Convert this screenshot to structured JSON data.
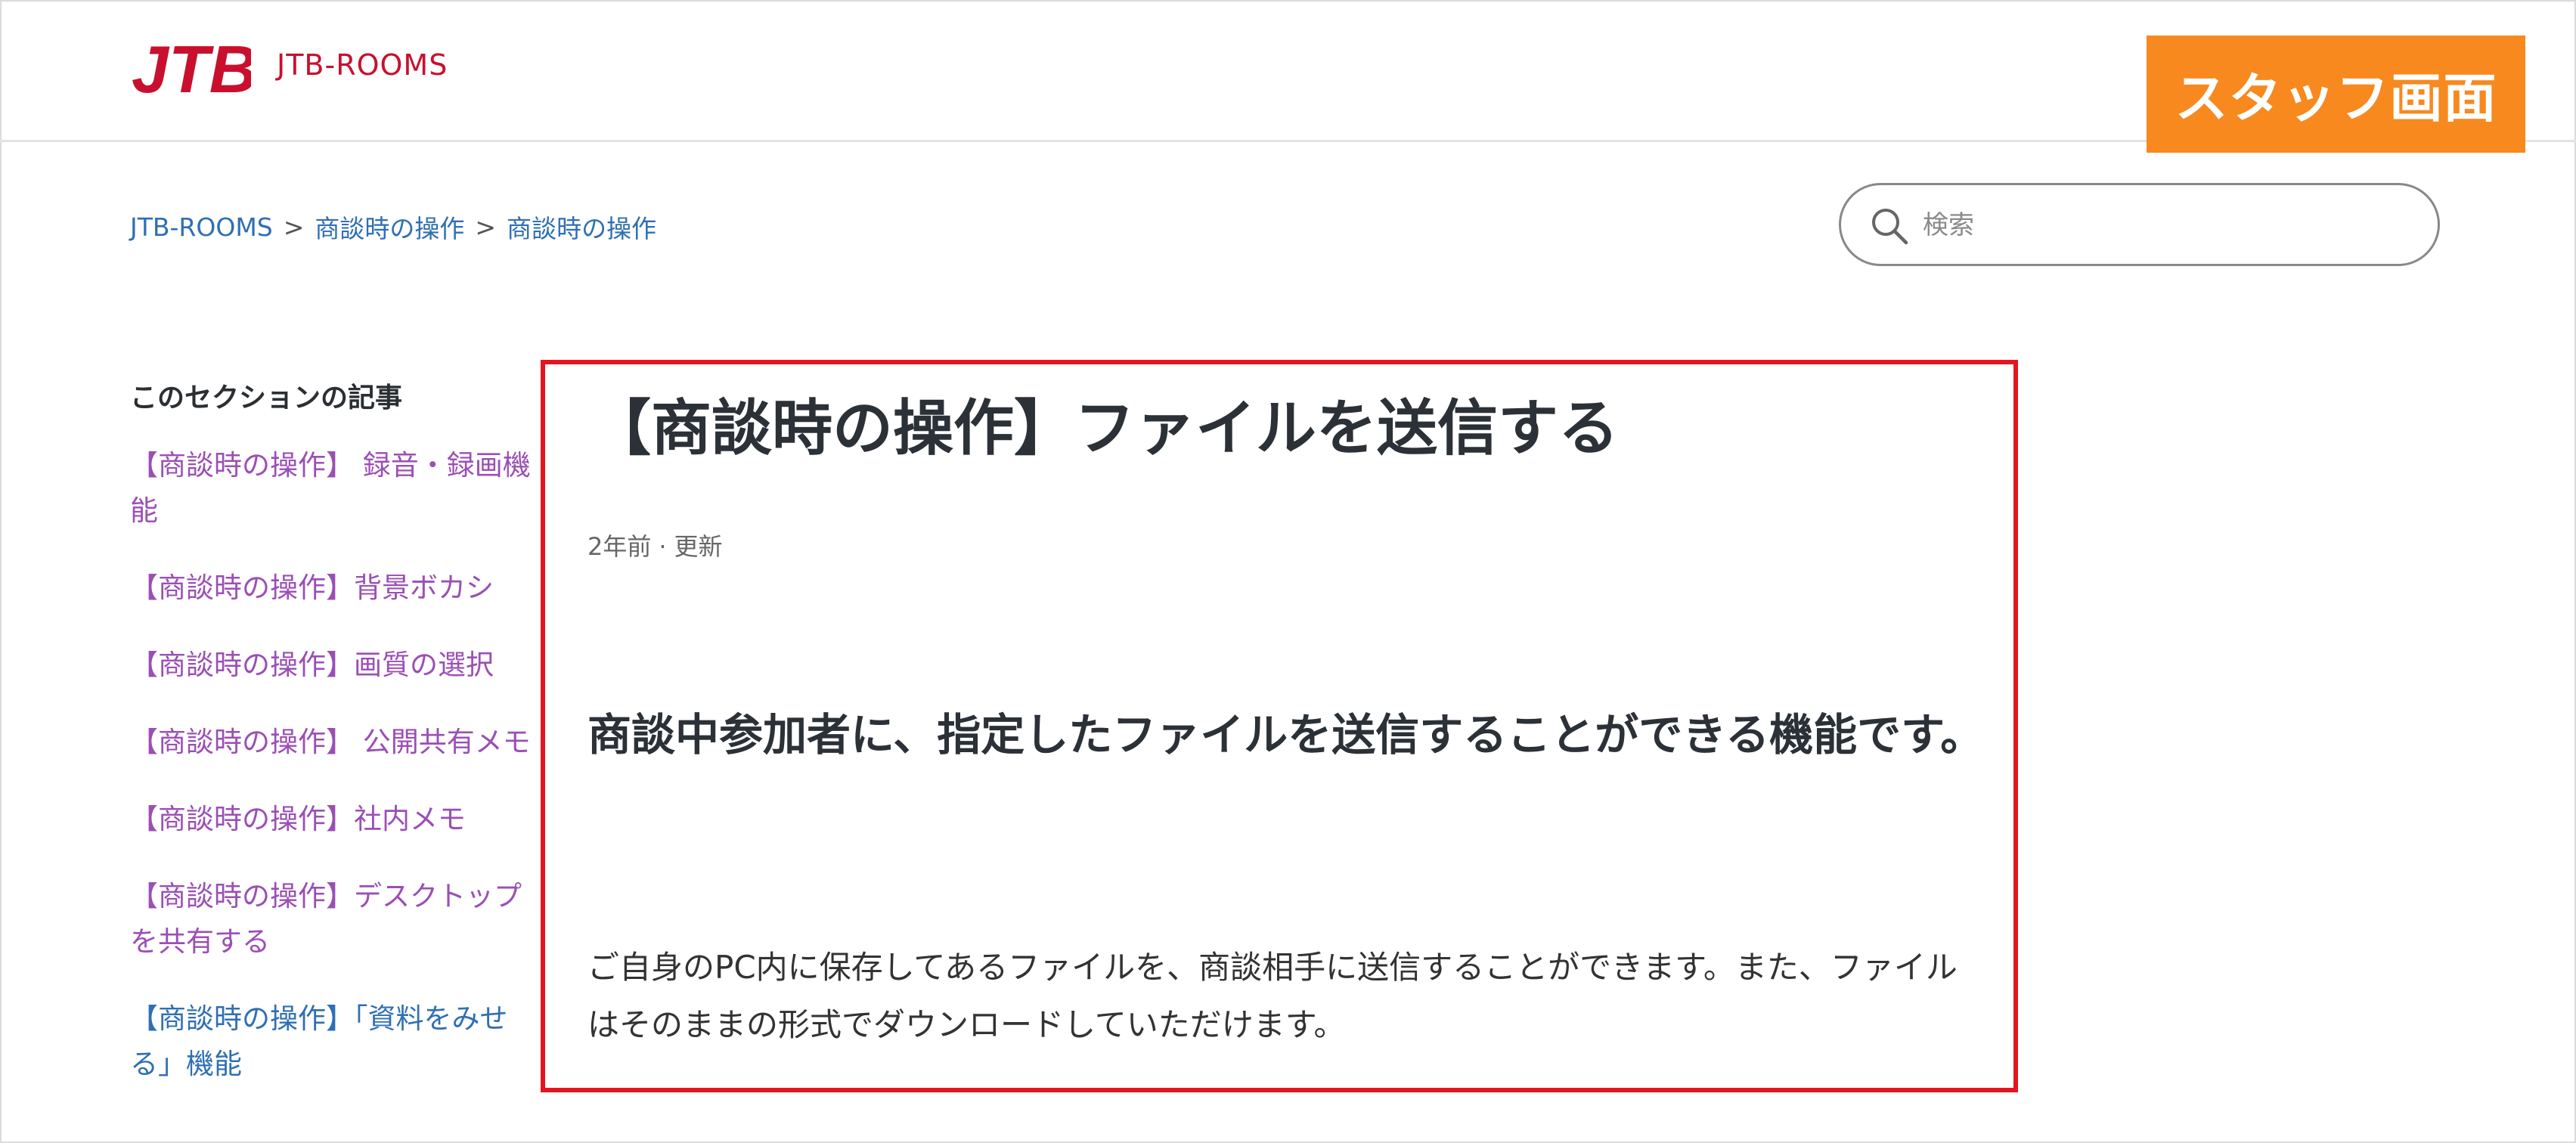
{
  "header": {
    "logo_text": "JTB",
    "brand_name": "JTB-ROOMS",
    "staff_badge": "スタッフ画面"
  },
  "breadcrumb": {
    "items": [
      "JTB-ROOMS",
      "商談時の操作",
      "商談時の操作"
    ],
    "separator": ">"
  },
  "search": {
    "placeholder": "検索"
  },
  "sidebar": {
    "title": "このセクションの記事",
    "items": [
      {
        "label": "【商談時の操作】 録音・録画機能",
        "visited": true
      },
      {
        "label": "【商談時の操作】背景ボカシ",
        "visited": true
      },
      {
        "label": "【商談時の操作】画質の選択",
        "visited": true
      },
      {
        "label": "【商談時の操作】 公開共有メモ",
        "visited": true
      },
      {
        "label": "【商談時の操作】社内メモ",
        "visited": true
      },
      {
        "label": "【商談時の操作】デスクトップを共有する",
        "visited": true
      },
      {
        "label": "【商談時の操作】「資料をみせる」機能",
        "visited": false
      }
    ]
  },
  "article": {
    "title": "【商談時の操作】ファイルを送信する",
    "meta_time": "2年前",
    "meta_dot": "·",
    "meta_updated": "更新",
    "heading": "商談中参加者に、指定したファイルを送信することができる機能です。",
    "body": "ご自身のPC内に保存してあるファイルを、商談相手に送信することができます。また、ファイルはそのままの形式でダウンロードしていただけます。"
  },
  "colors": {
    "brand_red": "#c8102e",
    "staff_orange": "#f7891f",
    "link_blue": "#2f6fb3",
    "visited_purple": "#9b4fb5",
    "highlight_red": "#e4151f"
  }
}
